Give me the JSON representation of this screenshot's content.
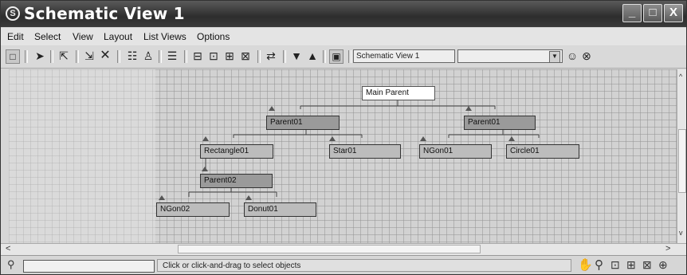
{
  "window": {
    "title": "Schematic View 1",
    "minimize": "_",
    "maximize": "□",
    "close": "X",
    "app_icon": "⑤"
  },
  "menu": [
    "Edit",
    "Select",
    "View",
    "Layout",
    "List Views",
    "Options"
  ],
  "toolbar": {
    "view_name": "Schematic View 1",
    "dropdown_value": ""
  },
  "nodes": {
    "main_parent": "Main Parent",
    "parent01_a": "Parent01",
    "parent01_b": "Parent01",
    "rectangle01": "Rectangle01",
    "star01": "Star01",
    "ngon01": "NGon01",
    "circle01": "Circle01",
    "parent02": "Parent02",
    "ngon02": "NGon02",
    "donut01": "Donut01"
  },
  "status": {
    "prompt": "Click or click-and-drag to select objects",
    "input_value": ""
  },
  "icons": [
    "select-arrow-icon",
    "link-icon",
    "unlink-icon",
    "delete-icon",
    "hierarchy-icon",
    "references-icon",
    "list-icon",
    "zoom-icon",
    "pan-icon",
    "zoom-region-icon",
    "zoom-extents-icon",
    "zoom-selected-icon"
  ]
}
